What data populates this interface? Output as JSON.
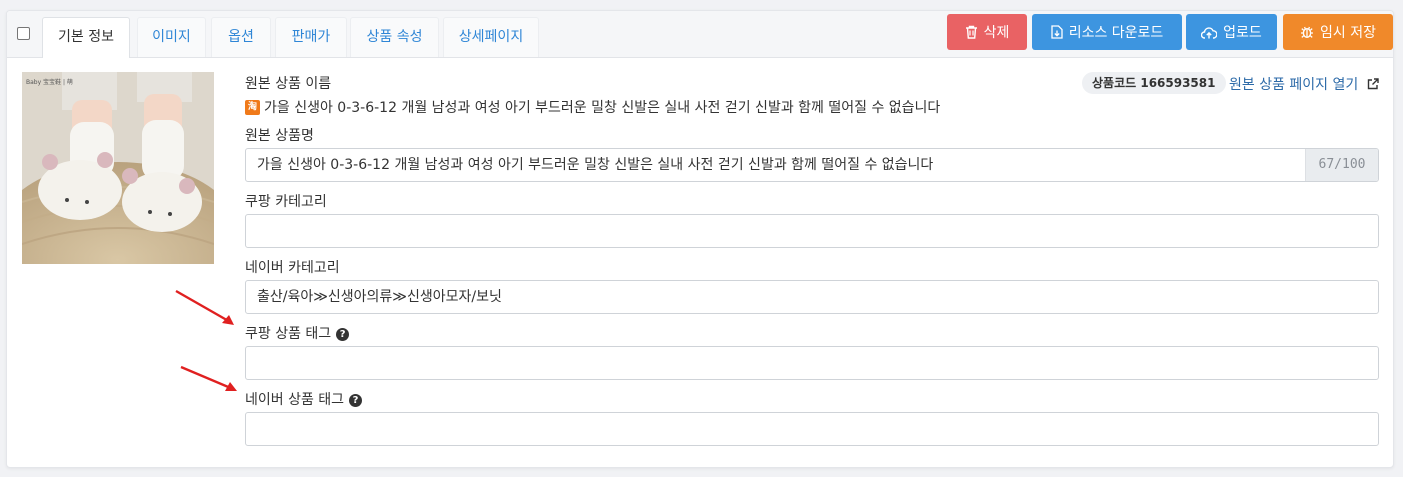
{
  "tabs": [
    {
      "label": "기본 정보",
      "active": true
    },
    {
      "label": "이미지"
    },
    {
      "label": "옵션"
    },
    {
      "label": "판매가"
    },
    {
      "label": "상품 속성"
    },
    {
      "label": "상세페이지"
    }
  ],
  "toolbar": {
    "delete_label": "삭제",
    "download_label": "리소스 다운로드",
    "upload_label": "업로드",
    "save_label": "임시 저장"
  },
  "colors": {
    "delete": "#e96264",
    "download": "#3d95e0",
    "upload": "#3d95e0",
    "save": "#f0892a",
    "link": "#2c6aa8"
  },
  "product": {
    "original_name_label": "원본 상품 이름",
    "original_name": "가을 신생아 0-3-6-12 개월 남성과 여성 아기 부드러운 밀창 신발은 실내 사전 걷기 신발과 함께 떨어질 수 없습니다",
    "source_icon": "taobao-icon",
    "image_caption": "Baby 宝宝鞋 | 萌",
    "code_badge": "상품코드 166593581",
    "open_source_link": "원본 상품 페이지 열기"
  },
  "fields": {
    "product_name": {
      "label": "원본 상품명",
      "value": "가을 신생아 0-3-6-12 개월 남성과 여성 아기 부드러운 밀창 신발은 실내 사전 걷기 신발과 함께 떨어질 수 없습니다",
      "counter": "67/100"
    },
    "coupang_category": {
      "label": "쿠팡 카테고리",
      "value": ""
    },
    "naver_category": {
      "label": "네이버 카테고리",
      "value": "출산/육아≫신생아의류≫신생아모자/보닛"
    },
    "coupang_tags": {
      "label": "쿠팡 상품 태그",
      "value": ""
    },
    "naver_tags": {
      "label": "네이버 상품 태그",
      "value": ""
    }
  }
}
